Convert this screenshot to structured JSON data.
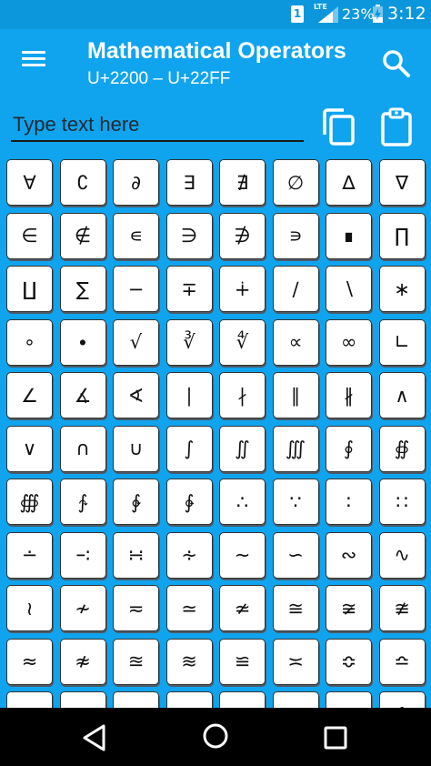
{
  "status_bar": {
    "sim": "1",
    "network": "LTE",
    "battery": "23%",
    "time": "3:12",
    "icons": [
      "sim-icon",
      "signal-icon",
      "battery-charging-icon"
    ]
  },
  "app_bar": {
    "title": "Mathematical Operators",
    "subtitle": "U+2200 – U+22FF",
    "icons": [
      "menu-icon",
      "search-icon"
    ]
  },
  "input": {
    "placeholder": "Type text here",
    "value": "",
    "icons": [
      "copy-icon",
      "clipboard-icon"
    ]
  },
  "keys": [
    "∀",
    "∁",
    "∂",
    "∃",
    "∄",
    "∅",
    "∆",
    "∇",
    "∈",
    "∉",
    "∊",
    "∋",
    "∌",
    "∍",
    "∎",
    "∏",
    "∐",
    "∑",
    "−",
    "∓",
    "∔",
    "∕",
    "∖",
    "∗",
    "∘",
    "∙",
    "√",
    "∛",
    "∜",
    "∝",
    "∞",
    "∟",
    "∠",
    "∡",
    "∢",
    "∣",
    "∤",
    "∥",
    "∦",
    "∧",
    "∨",
    "∩",
    "∪",
    "∫",
    "∬",
    "∭",
    "∮",
    "∯",
    "∰",
    "∱",
    "∲",
    "∳",
    "∴",
    "∵",
    "∶",
    "∷",
    "∸",
    "∹",
    "∺",
    "∻",
    "∼",
    "∽",
    "∾",
    "∿",
    "≀",
    "≁",
    "≂",
    "≃",
    "≄",
    "≅",
    "≆",
    "≇",
    "≈",
    "≉",
    "≊",
    "≋",
    "≌",
    "≍",
    "≎",
    "≏",
    "≐",
    "≑",
    "≒",
    "≓",
    "≔",
    "≕",
    "≖",
    "≗"
  ],
  "nav_bar": {
    "icons": [
      "back-icon",
      "home-icon",
      "recents-icon"
    ]
  },
  "colors": {
    "background": "#10a4ee",
    "status_bar": "#0c97dd",
    "key_fill": "#ffffff",
    "nav_bar": "#000000"
  }
}
